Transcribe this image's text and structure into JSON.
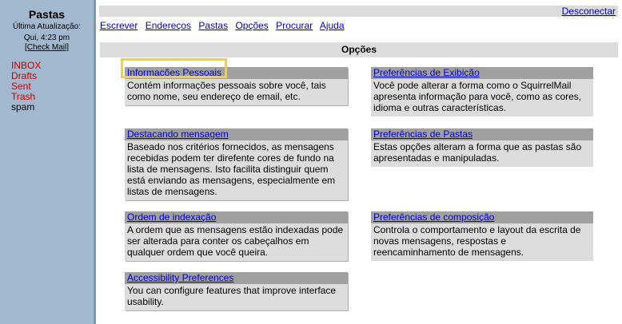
{
  "sidebar": {
    "title": "Pastas",
    "updated_label": "Última Atualização:",
    "updated_time": "Qui, 4:23 pm",
    "check_mail": "[Check Mail]",
    "folders": [
      {
        "label": "INBOX",
        "special": true
      },
      {
        "label": "Drafts",
        "special": true
      },
      {
        "label": "Sent",
        "special": true
      },
      {
        "label": "Trash",
        "special": true
      },
      {
        "label": "spam",
        "special": false
      }
    ]
  },
  "topbar": {
    "signout": "Desconectar"
  },
  "menu": [
    {
      "label": "Escrever"
    },
    {
      "label": "Endereços"
    },
    {
      "label": "Pastas"
    },
    {
      "label": "Opções"
    },
    {
      "label": "Procurar"
    },
    {
      "label": "Ajuda"
    }
  ],
  "options": {
    "header": "Opções",
    "items": [
      {
        "title": "Informações Pessoais",
        "desc": "Contém informações pessoais sobre você, tais como nome, seu endereço de email, etc."
      },
      {
        "title": "Preferências de Exibição",
        "desc": "Você pode alterar a forma como o SquirrelMail apresenta informação para você, como as cores, idioma e outras características."
      },
      {
        "title": "Destacando mensagem",
        "desc": "Baseado nos critérios fornecidos, as mensagens recebidas podem ter direfente cores de fundo na lista de mensagens. Isto facilita distinguir quem está enviando as mensagens, especialmente em listas de mensagens."
      },
      {
        "title": "Preferências de Pastas",
        "desc": "Estas opções alteram a forma que as pastas são apresentadas e manipuladas."
      },
      {
        "title": "Ordem de indexação",
        "desc": "A ordem que as mensagens estão indexadas pode ser alterada para conter os cabeçalhos em qualquer ordem que você queira."
      },
      {
        "title": "Preferências de composição",
        "desc": "Controla o comportamento e layout da escrita de novas mensagens, respostas e reencaminhamento de mensagens."
      },
      {
        "title": "Accessibility Preferences",
        "desc": "You can configure features that improve interface usability."
      }
    ]
  },
  "colors": {
    "sidebar_bg": "#a2b8cf",
    "header_bg": "#dcdcdc",
    "option_title_bg": "#a0a0a0",
    "link": "#0000cc",
    "special_folder": "#cc0000",
    "highlight": "#f3d334"
  }
}
